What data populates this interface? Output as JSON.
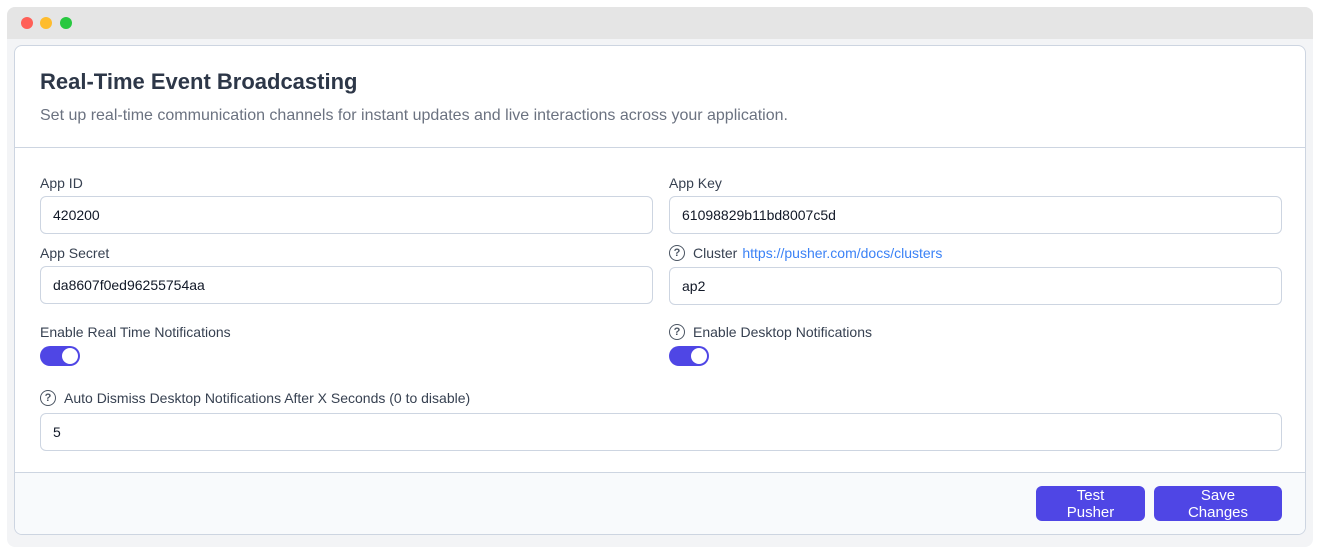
{
  "window": {
    "controls": [
      "close",
      "minimize",
      "maximize"
    ]
  },
  "header": {
    "title": "Real-Time Event Broadcasting",
    "subtitle": "Set up real-time communication channels for instant updates and live interactions across your application."
  },
  "form": {
    "app_id": {
      "label": "App ID",
      "value": "420200"
    },
    "app_key": {
      "label": "App Key",
      "value": "61098829b11bd8007c5d"
    },
    "app_secret": {
      "label": "App Secret",
      "value": "da8607f0ed96255754aa"
    },
    "cluster": {
      "label": "Cluster",
      "link_text": "https://pusher.com/docs/clusters",
      "value": "ap2",
      "help_icon": "question-circle"
    },
    "realtime_notifications": {
      "label": "Enable Real Time Notifications",
      "enabled": true
    },
    "desktop_notifications": {
      "label": "Enable Desktop Notifications",
      "enabled": true,
      "help_icon": "question-circle"
    },
    "auto_dismiss": {
      "label": "Auto Dismiss Desktop Notifications After X Seconds (0 to disable)",
      "value": "5",
      "help_icon": "question-circle"
    }
  },
  "footer": {
    "test_label": "Test Pusher",
    "save_label": "Save Changes"
  },
  "colors": {
    "accent": "#4f46e5",
    "link": "#3b82f6",
    "border": "#cdd5e1"
  }
}
